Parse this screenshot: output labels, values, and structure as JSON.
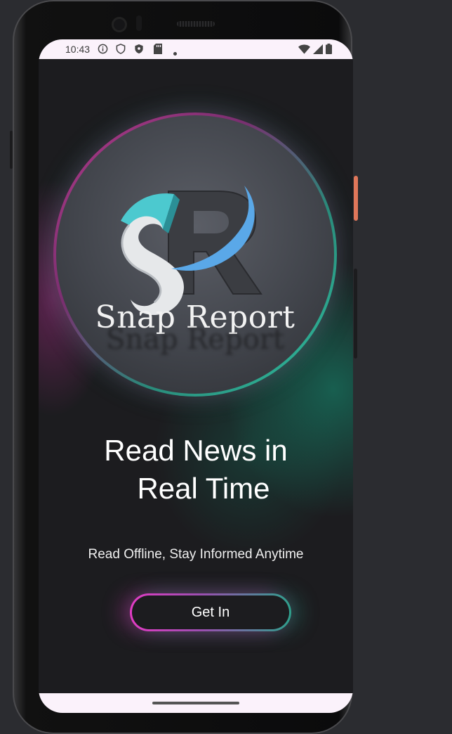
{
  "status_bar": {
    "time": "10:43",
    "left_icons": [
      "info-icon",
      "shield-icon",
      "shield-filled-icon",
      "sd-card-icon",
      "dot-icon"
    ],
    "right_icons": [
      "wifi-icon",
      "signal-icon",
      "battery-icon"
    ]
  },
  "logo": {
    "brand_text": "Snap Report",
    "reflection_text": "Snap Report"
  },
  "main": {
    "headline_line1": "Read News in",
    "headline_line2": "Real Time",
    "subtitle": "Read Offline, Stay Informed Anytime",
    "cta_label": "Get In"
  },
  "colors": {
    "background": "#1c1c1f",
    "accent_pink": "#e23cc4",
    "accent_teal": "#2fa08c",
    "system_bar": "#fbf2fb"
  }
}
